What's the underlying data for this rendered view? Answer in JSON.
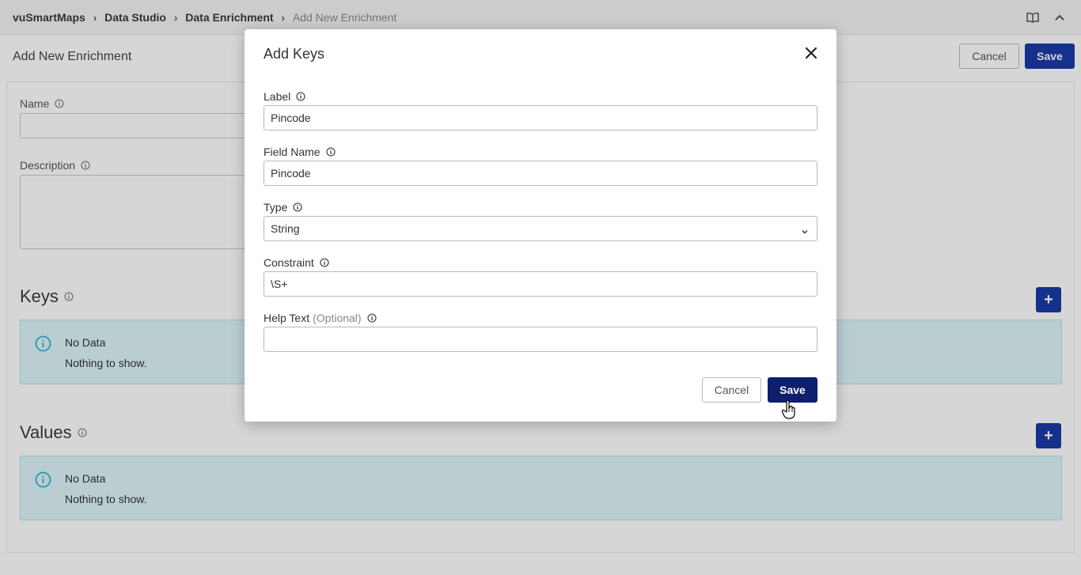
{
  "breadcrumb": [
    "vuSmartMaps",
    "Data Studio",
    "Data Enrichment",
    "Add New Enrichment"
  ],
  "icons": {
    "book": "book-icon",
    "collapse": "chevron-up-icon",
    "info": "info-icon",
    "close": "close-icon",
    "plus": "plus-icon",
    "dropdown": "chevron-down-icon",
    "cursor": "hand-cursor-icon"
  },
  "page": {
    "title": "Add New Enrichment",
    "cancel_label": "Cancel",
    "save_label": "Save",
    "name_label": "Name",
    "description_label": "Description",
    "keys_title": "Keys",
    "values_title": "Values",
    "add_label": "+",
    "keys_empty": {
      "title": "No Data",
      "message": "Nothing to show."
    },
    "values_empty": {
      "title": "No Data",
      "message": "Nothing to show."
    }
  },
  "modal": {
    "title": "Add Keys",
    "fields": {
      "label": {
        "label": "Label",
        "value": "Pincode"
      },
      "field_name": {
        "label": "Field Name",
        "value": "Pincode"
      },
      "type": {
        "label": "Type",
        "value": "String"
      },
      "constraint": {
        "label": "Constraint",
        "value": "\\S+"
      },
      "help_text": {
        "label": "Help Text",
        "optional": "(Optional)",
        "value": ""
      }
    },
    "cancel_label": "Cancel",
    "save_label": "Save"
  },
  "colors": {
    "primary": "#1a3aa8",
    "modal_save": "#0e1f6e",
    "empty_bg": "#def6fb",
    "info_icon": "#2fb4cf"
  }
}
